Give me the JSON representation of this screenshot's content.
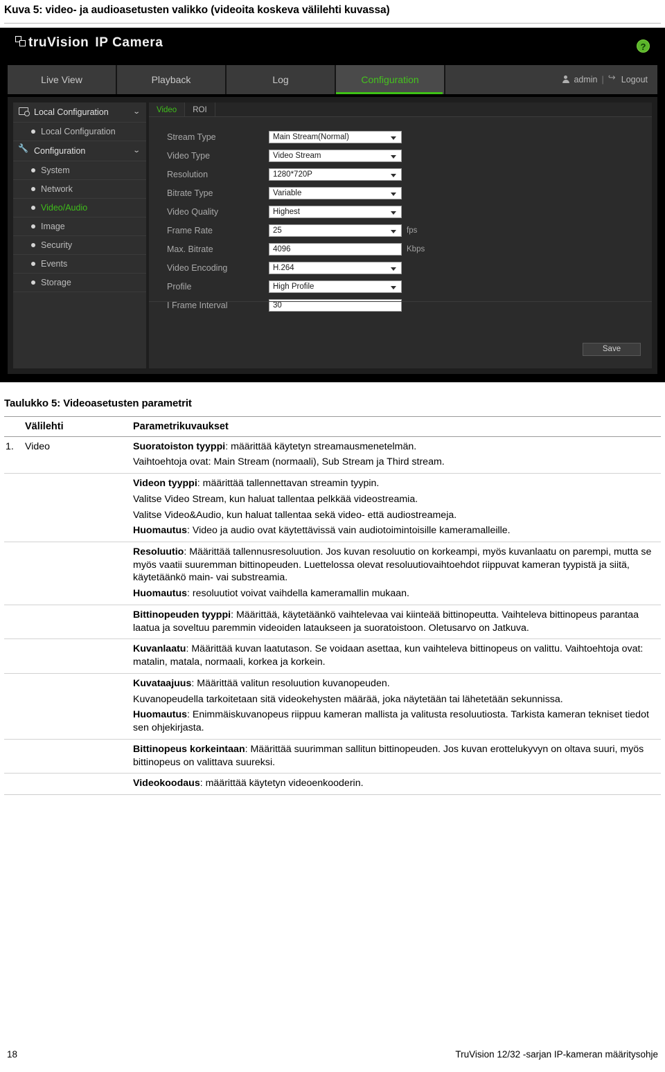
{
  "figure": {
    "caption": "Kuva 5: video- ja audioasetusten valikko (videoita koskeva välilehti kuvassa)"
  },
  "camera_ui": {
    "brand": {
      "name": "truVision",
      "product": "IP Camera",
      "logo_icon": "stacked-squares-icon"
    },
    "help_label": "?",
    "nav_tabs": [
      {
        "label": "Live View",
        "active": false
      },
      {
        "label": "Playback",
        "active": false
      },
      {
        "label": "Log",
        "active": false
      },
      {
        "label": "Configuration",
        "active": true
      }
    ],
    "user": {
      "name": "admin",
      "separator": "|",
      "logout_label": "Logout"
    },
    "sidebar": {
      "groups": [
        {
          "label": "Local Configuration",
          "icon": "monitor-gear-icon",
          "chevron": "⌄",
          "items": [
            {
              "label": "Local Configuration",
              "active": false
            }
          ]
        },
        {
          "label": "Configuration",
          "icon": "wrench-icon",
          "chevron": "⌄",
          "items": [
            {
              "label": "System",
              "active": false
            },
            {
              "label": "Network",
              "active": false
            },
            {
              "label": "Video/Audio",
              "active": true
            },
            {
              "label": "Image",
              "active": false
            },
            {
              "label": "Security",
              "active": false
            },
            {
              "label": "Events",
              "active": false
            },
            {
              "label": "Storage",
              "active": false
            }
          ]
        }
      ]
    },
    "content_tabs": [
      {
        "label": "Video",
        "active": true
      },
      {
        "label": "ROI",
        "active": false
      }
    ],
    "form_fields": [
      {
        "label": "Stream Type",
        "value": "Main Stream(Normal)",
        "type": "select",
        "unit": ""
      },
      {
        "label": "Video Type",
        "value": "Video Stream",
        "type": "select",
        "unit": ""
      },
      {
        "label": "Resolution",
        "value": "1280*720P",
        "type": "select",
        "unit": ""
      },
      {
        "label": "Bitrate Type",
        "value": "Variable",
        "type": "select",
        "unit": ""
      },
      {
        "label": "Video Quality",
        "value": "Highest",
        "type": "select",
        "unit": ""
      },
      {
        "label": "Frame Rate",
        "value": "25",
        "type": "select",
        "unit": "fps"
      },
      {
        "label": "Max. Bitrate",
        "value": "4096",
        "type": "input",
        "unit": "Kbps"
      },
      {
        "label": "Video Encoding",
        "value": "H.264",
        "type": "select",
        "unit": ""
      },
      {
        "label": "Profile",
        "value": "High Profile",
        "type": "select",
        "unit": ""
      },
      {
        "label": "I Frame Interval",
        "value": "30",
        "type": "input",
        "unit": ""
      }
    ],
    "save_label": "Save",
    "colors": {
      "accent_green": "#3fbe1b",
      "panel_dark": "#2b2b2b",
      "header_black": "#000000"
    }
  },
  "table": {
    "title": "Taulukko 5: Videoasetusten parametrit",
    "headers": {
      "num": "",
      "tab": "Välilehti",
      "desc": "Parametrikuvaukset"
    },
    "row_number": "1.",
    "row_tab": "Video",
    "rows": [
      {
        "paragraphs": [
          {
            "bold": "Suoratoiston tyyppi",
            "text": ": määrittää käytetyn streamausmenetelmän."
          },
          {
            "bold": "",
            "text": "Vaihtoehtoja ovat: Main Stream (normaali), Sub Stream ja Third stream."
          }
        ]
      },
      {
        "paragraphs": [
          {
            "bold": "Videon tyyppi",
            "text": ": määrittää tallennettavan streamin tyypin."
          },
          {
            "bold": "",
            "text": "Valitse Video Stream, kun haluat tallentaa pelkkää videostreamia."
          },
          {
            "bold": "",
            "text": "Valitse Video&Audio, kun haluat tallentaa sekä video- että audiostreameja."
          },
          {
            "bold": "Huomautus",
            "text": ": Video ja audio ovat käytettävissä vain audiotoimintoisille kameramalleille."
          }
        ]
      },
      {
        "paragraphs": [
          {
            "bold": "Resoluutio",
            "text": ": Määrittää tallennusresoluution. Jos kuvan resoluutio on korkeampi, myös kuvanlaatu on parempi, mutta se myös vaatii suuremman bittinopeuden. Luettelossa olevat resoluutiovaihtoehdot riippuvat kameran tyypistä ja siitä, käytetäänkö main- vai substreamia."
          },
          {
            "bold": "Huomautus",
            "text": ": resoluutiot voivat vaihdella kameramallin mukaan."
          }
        ]
      },
      {
        "paragraphs": [
          {
            "bold": "Bittinopeuden tyyppi",
            "text": ": Määrittää, käytetäänkö vaihtelevaa vai kiinteää bittinopeutta. Vaihteleva bittinopeus parantaa laatua ja soveltuu paremmin videoiden lataukseen ja suoratoistoon. Oletusarvo on Jatkuva."
          }
        ]
      },
      {
        "paragraphs": [
          {
            "bold": "Kuvanlaatu",
            "text": ": Määrittää kuvan laatutason. Se voidaan asettaa, kun vaihteleva bittinopeus on valittu. Vaihtoehtoja ovat: matalin, matala, normaali, korkea ja korkein."
          }
        ]
      },
      {
        "paragraphs": [
          {
            "bold": "Kuvataajuus",
            "text": ": Määrittää valitun resoluution kuvanopeuden."
          },
          {
            "bold": "",
            "text": "Kuvanopeudella tarkoitetaan sitä videokehysten määrää, joka näytetään tai lähetetään sekunnissa."
          },
          {
            "bold": "Huomautus",
            "text": ": Enimmäiskuvanopeus riippuu kameran mallista ja valitusta resoluutiosta. Tarkista kameran tekniset tiedot sen ohjekirjasta."
          }
        ]
      },
      {
        "paragraphs": [
          {
            "bold": "Bittinopeus korkeintaan",
            "text": ": Määrittää suurimman sallitun bittinopeuden. Jos kuvan erottelukyvyn on oltava suuri, myös bittinopeus on valittava suureksi."
          }
        ]
      },
      {
        "paragraphs": [
          {
            "bold": "Videokoodaus",
            "text": ": määrittää käytetyn videoenkooderin."
          }
        ]
      }
    ]
  },
  "footer": {
    "page_number": "18",
    "document_title": "TruVision 12/32 -sarjan IP-kameran määritysohje"
  }
}
